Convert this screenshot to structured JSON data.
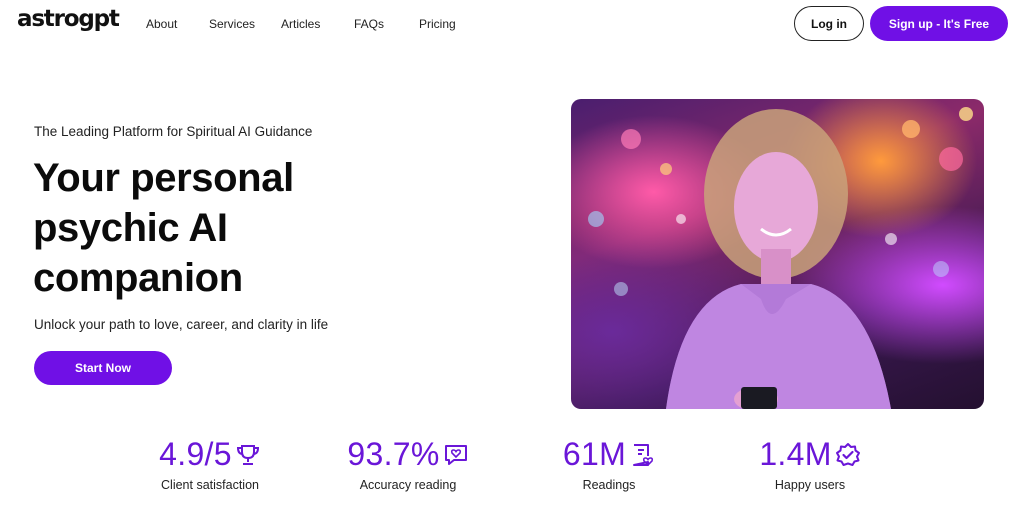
{
  "nav": {
    "logo": "astrogpt",
    "links": [
      "About",
      "Services",
      "Articles",
      "FAQs",
      "Pricing"
    ],
    "login_label": "Log in",
    "signup_label": "Sign up - It's Free"
  },
  "hero": {
    "tagline": "The Leading Platform for Spiritual AI Guidance",
    "headline": "Your personal psychic AI companion",
    "subline": "Unlock your path to love, career, and clarity in life",
    "cta_label": "Start Now",
    "image_icon": "woman-with-phone-photo"
  },
  "stats": [
    {
      "value": "4.9/5",
      "label": "Client satisfaction",
      "icon": "trophy-icon"
    },
    {
      "value": "93.7%",
      "label": "Accuracy reading",
      "icon": "heart-chat-icon"
    },
    {
      "value": "61M",
      "label": "Readings",
      "icon": "document-heart-icon"
    },
    {
      "value": "1.4M",
      "label": "Happy users",
      "icon": "verified-badge-icon"
    }
  ],
  "colors": {
    "accent": "#7010e6",
    "stat_text": "#6a16d8"
  }
}
